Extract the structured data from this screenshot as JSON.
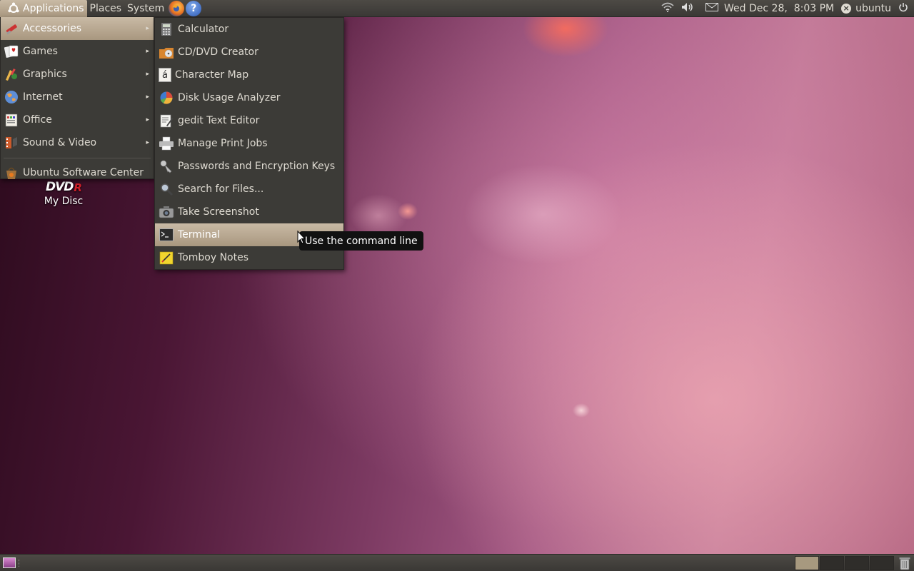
{
  "top_panel": {
    "menus": [
      "Applications",
      "Places",
      "System"
    ],
    "launchers": {
      "firefox": "firefox-icon",
      "help": "?"
    },
    "tray": {
      "network": "wifi-icon",
      "volume": "volume-icon",
      "mail": "mail-icon",
      "clock": "Wed Dec 28,  8:03 PM",
      "user": "ubuntu",
      "power": "power-icon"
    }
  },
  "main_menu": {
    "items": [
      {
        "label": "Accessories",
        "icon": "accessories-icon",
        "submenu": true,
        "active": true
      },
      {
        "label": "Games",
        "icon": "games-icon",
        "submenu": true
      },
      {
        "label": "Graphics",
        "icon": "graphics-icon",
        "submenu": true
      },
      {
        "label": "Internet",
        "icon": "internet-icon",
        "submenu": true
      },
      {
        "label": "Office",
        "icon": "office-icon",
        "submenu": true
      },
      {
        "label": "Sound & Video",
        "icon": "sound-video-icon",
        "submenu": true
      }
    ],
    "footer": {
      "label": "Ubuntu Software Center",
      "icon": "software-center-icon"
    }
  },
  "accessories_menu": {
    "items": [
      {
        "label": "Calculator",
        "icon": "calculator-icon"
      },
      {
        "label": "CD/DVD Creator",
        "icon": "cd-dvd-creator-icon"
      },
      {
        "label": "Character Map",
        "icon": "character-map-icon",
        "glyph": "á"
      },
      {
        "label": "Disk Usage Analyzer",
        "icon": "disk-usage-icon"
      },
      {
        "label": "gedit Text Editor",
        "icon": "text-editor-icon"
      },
      {
        "label": "Manage Print Jobs",
        "icon": "printer-icon"
      },
      {
        "label": "Passwords and Encryption Keys",
        "icon": "keys-icon"
      },
      {
        "label": "Search for Files...",
        "icon": "search-icon"
      },
      {
        "label": "Take Screenshot",
        "icon": "camera-icon"
      },
      {
        "label": "Terminal",
        "icon": "terminal-icon",
        "active": true
      },
      {
        "label": "Tomboy Notes",
        "icon": "notes-icon"
      }
    ]
  },
  "tooltip": {
    "text": "Use the command line"
  },
  "desktop": {
    "icons": [
      {
        "label": "My Disc",
        "logo": "DVD",
        "logo_suffix": "R"
      }
    ]
  },
  "bottom_panel": {
    "workspace_count": 4,
    "active_workspace": 1
  },
  "colors": {
    "panel": "#3c3b37",
    "highlight": "#b6a68f",
    "menu_text": "#dfdbd2"
  }
}
